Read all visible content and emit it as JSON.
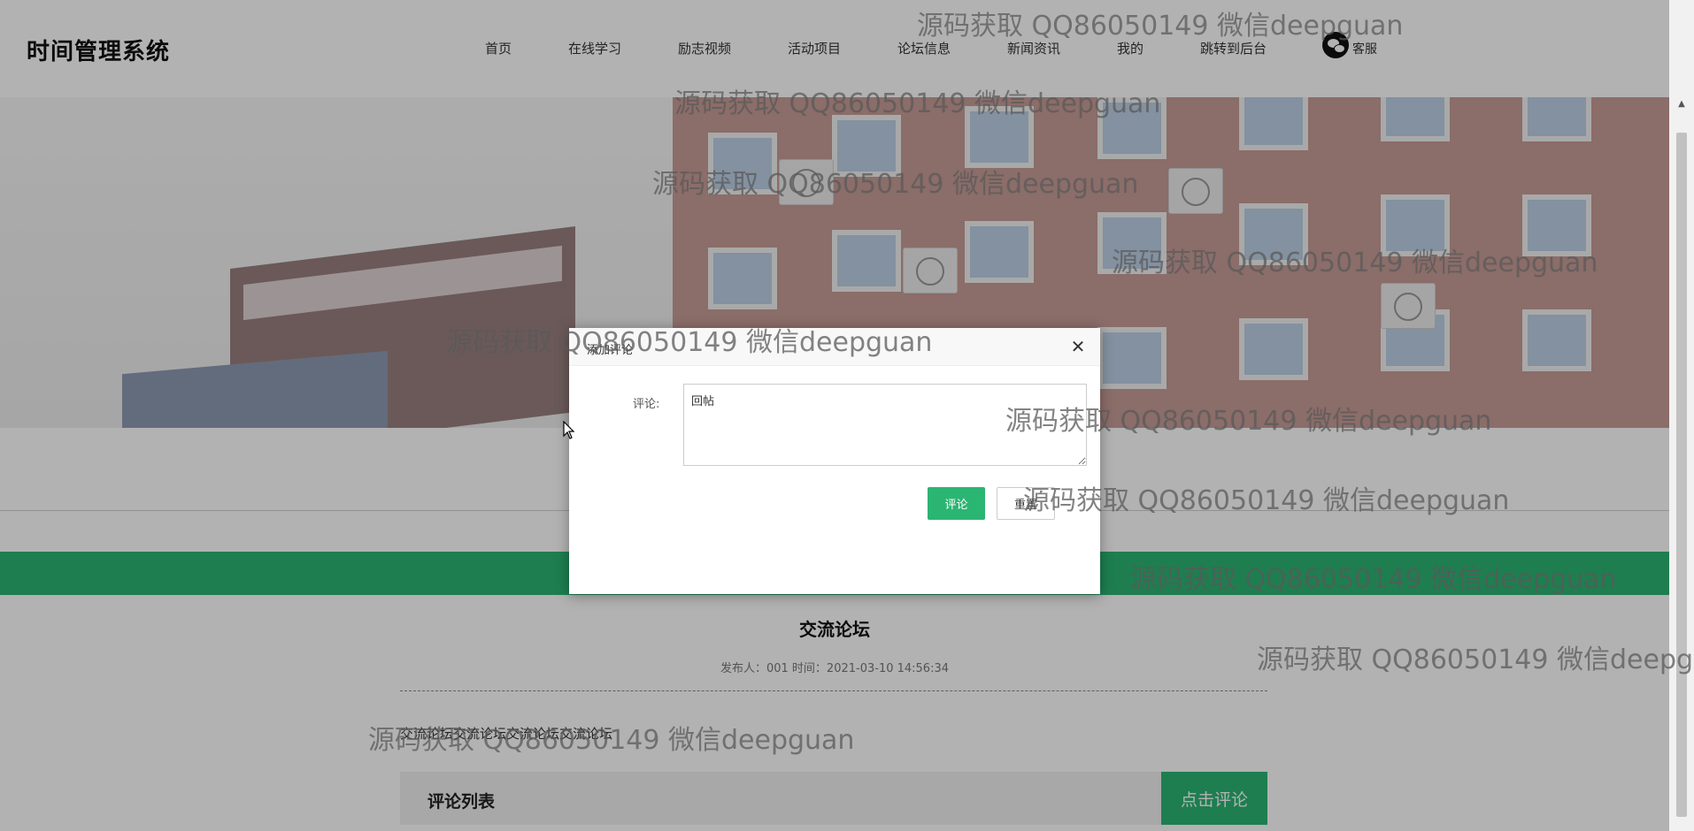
{
  "brand": "时间管理系统",
  "nav": {
    "items": [
      "首页",
      "在线学习",
      "励志视频",
      "活动项目",
      "论坛信息",
      "新闻资讯",
      "我的",
      "跳转到后台"
    ],
    "service_label": "客服"
  },
  "post": {
    "title": "交流论坛",
    "meta": "发布人：001 时间：2021-03-10 14:56:34",
    "body": "交流论坛交流论坛交流论坛交流论坛"
  },
  "comments": {
    "title": "评论列表",
    "button_label": "点击评论"
  },
  "dialog": {
    "title": "添加评论",
    "field_label": "评论:",
    "field_value": "回帖",
    "submit_label": "评论",
    "reset_label": "重置"
  },
  "watermark": "源码获取 QQ86050149 微信deepguan",
  "colors": {
    "accent": "#2bb573",
    "overlay": "rgba(0,0,0,0.30)"
  },
  "icons": {
    "service": "wechat-icon",
    "close": "close-icon",
    "cursor": "mouse-cursor-icon",
    "scroll_up": "scroll-up-arrow-icon"
  }
}
